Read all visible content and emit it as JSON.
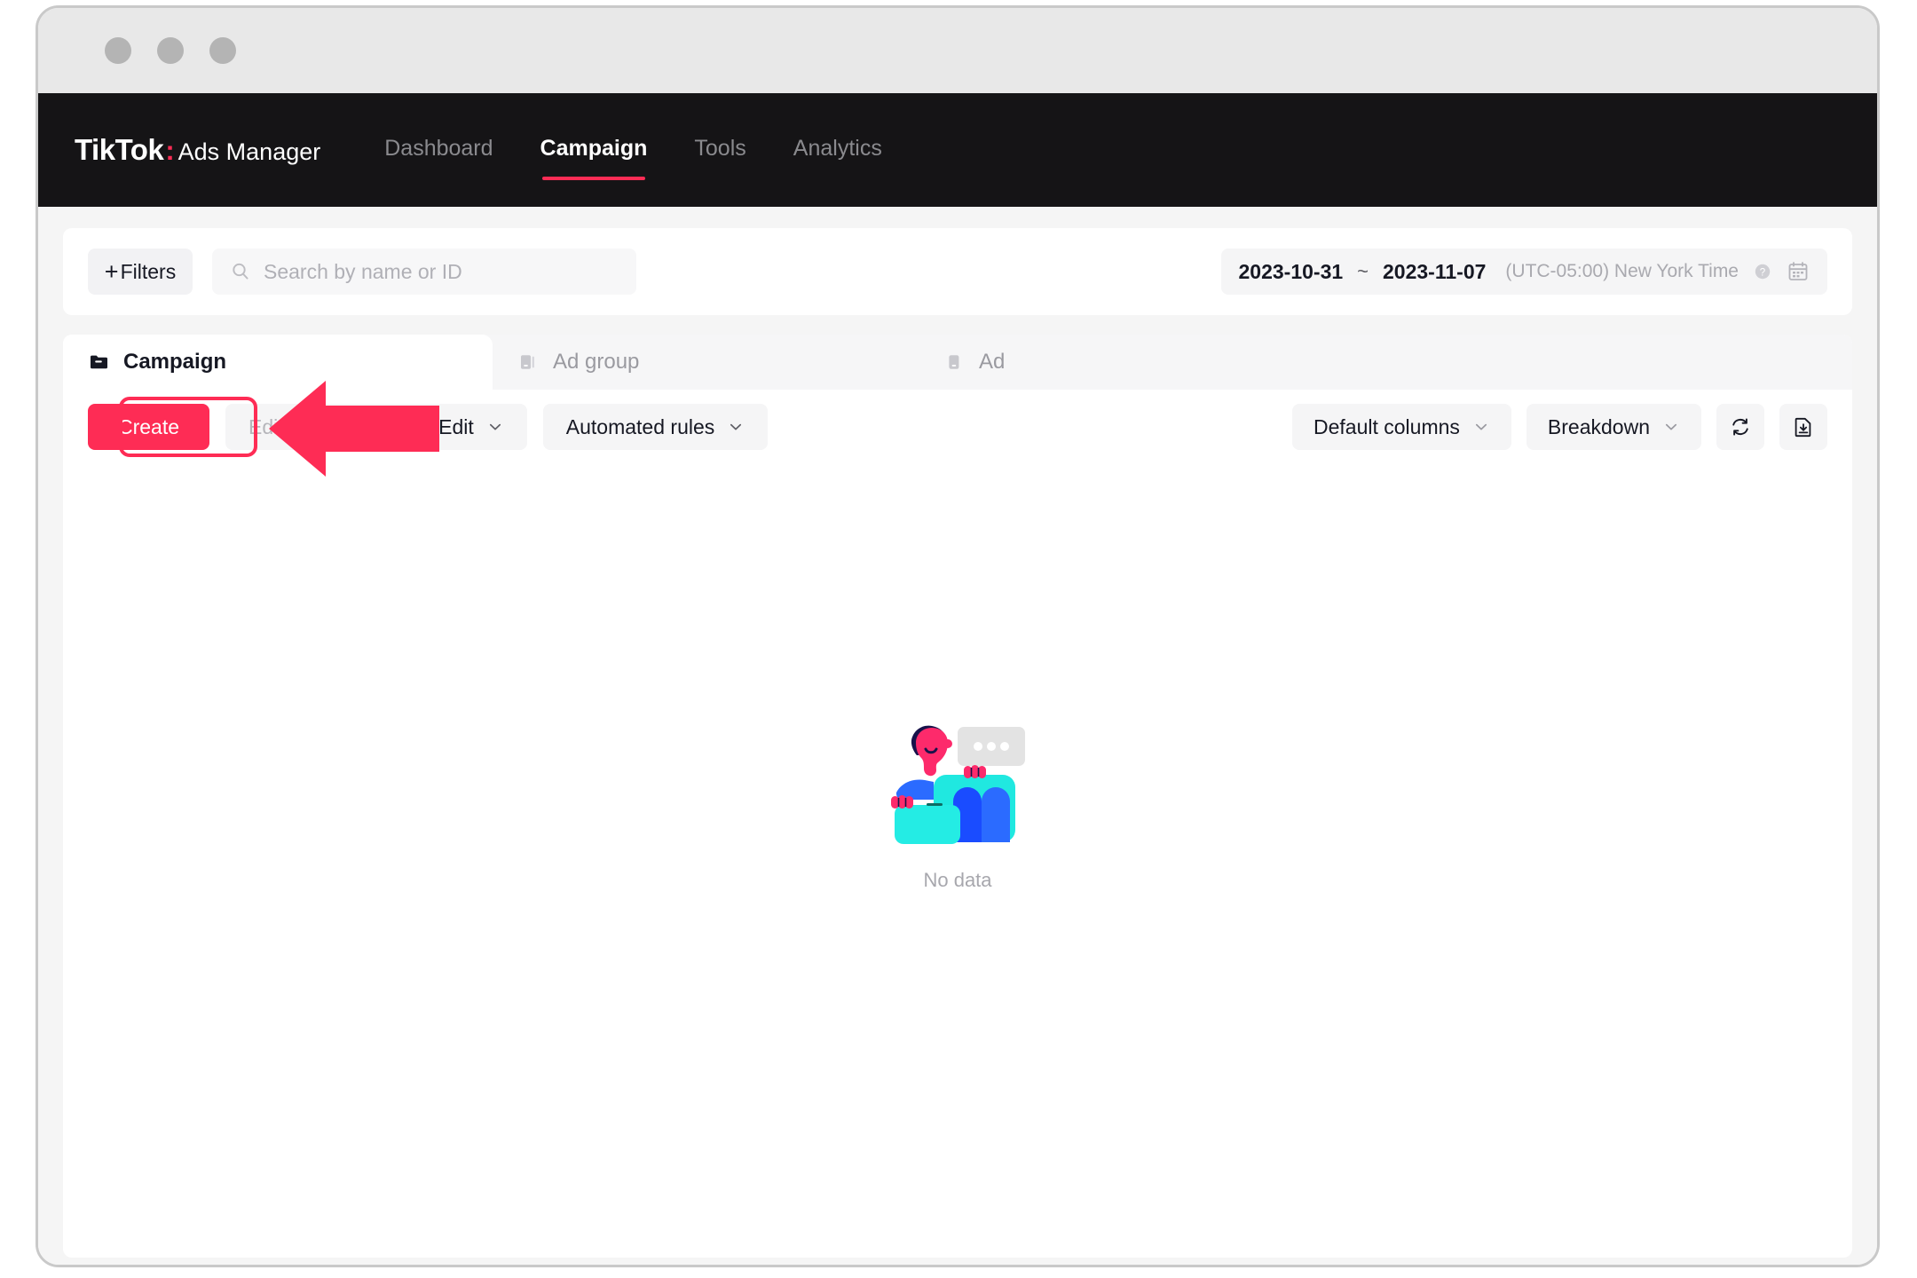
{
  "window": {
    "dots": [
      "window-dot-1",
      "window-dot-2",
      "window-dot-3"
    ]
  },
  "topnav": {
    "brand_primary": "TikTok",
    "brand_colon": ":",
    "brand_secondary": "Ads Manager",
    "items": [
      {
        "label": "Dashboard",
        "active": false
      },
      {
        "label": "Campaign",
        "active": true
      },
      {
        "label": "Tools",
        "active": false
      },
      {
        "label": "Analytics",
        "active": false
      }
    ]
  },
  "filters": {
    "plus": "+",
    "button_label": "Filters"
  },
  "search": {
    "placeholder": "Search by name or ID",
    "value": "",
    "icon": "search-icon"
  },
  "date_range": {
    "start": "2023-10-31",
    "separator": "~",
    "end": "2023-11-07",
    "timezone": "(UTC-05:00) New York Time",
    "help_icon": "question-circle-icon",
    "calendar_icon": "calendar-icon"
  },
  "tabs": [
    {
      "label": "Campaign",
      "icon": "folder-icon",
      "active": true
    },
    {
      "label": "Ad group",
      "icon": "adgroup-icon",
      "active": false
    },
    {
      "label": "Ad",
      "icon": "ad-icon",
      "active": false
    }
  ],
  "toolbar": {
    "create_label": "Create",
    "edit_label": "Edit",
    "bulk_label": "Bulk create/Edit",
    "automated_rules_label": "Automated rules",
    "default_columns_label": "Default columns",
    "breakdown_label": "Breakdown",
    "refresh_icon": "refresh-icon",
    "export_icon": "export-download-icon",
    "chevron_icon": "chevron-down-icon"
  },
  "empty_state": {
    "message": "No data",
    "illustration": "no-data-character-illustration"
  },
  "annotation": {
    "arrow": "left-pointing-arrow",
    "highlight_target": "create-button",
    "color": "#FE2C55"
  },
  "colors": {
    "brand_pink": "#FE2C55",
    "nav_background": "#151416",
    "page_background": "#F5F5F5",
    "card_background": "#FFFFFF",
    "control_grey": "#F5F5F6"
  }
}
